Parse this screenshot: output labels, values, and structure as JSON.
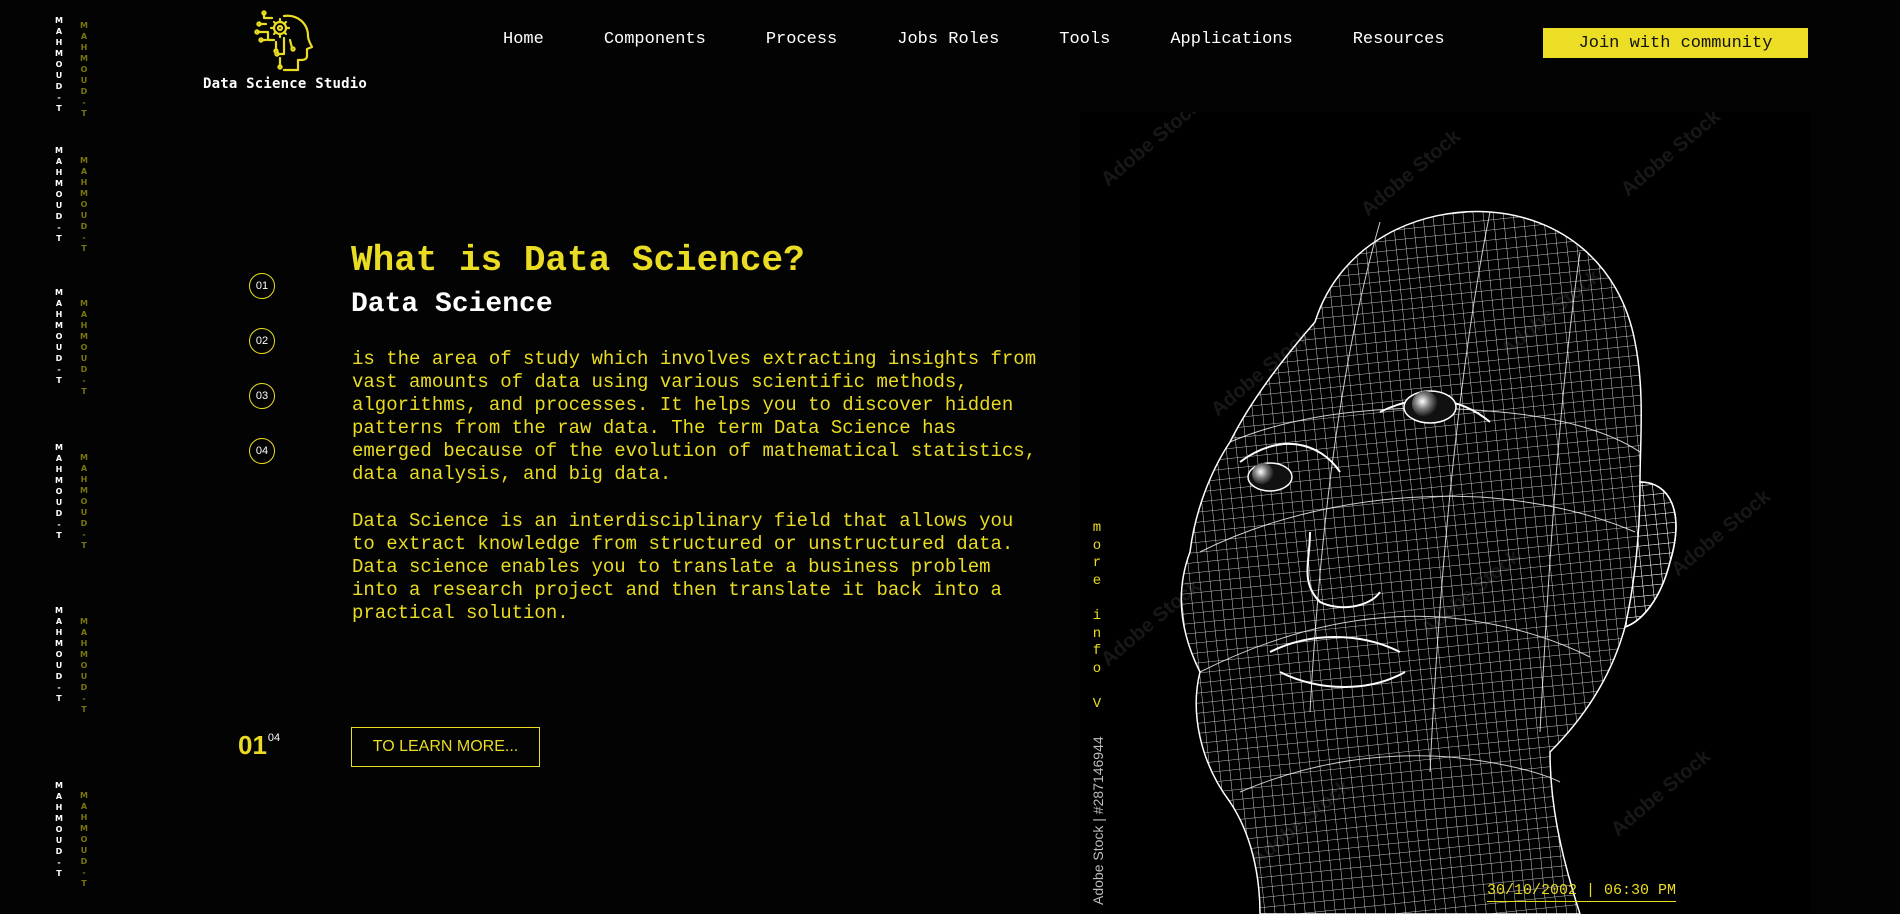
{
  "brand": {
    "name": "Data Science Studio"
  },
  "nav": {
    "items": [
      "Home",
      "Components",
      "Process",
      "Jobs Roles",
      "Tools",
      "Applications",
      "Resources"
    ],
    "cta": "Join with community"
  },
  "side_strip": {
    "tag_white": "MAHMOUD-T",
    "tag_yellow": "MAHMOUD-T"
  },
  "steps": [
    "01",
    "02",
    "03",
    "04"
  ],
  "content": {
    "title": "What is Data Science?",
    "subtitle": "Data Science",
    "paragraph1": "is the area of study which involves extracting insights from\nvast amounts of data using various scientific methods,\nalgorithms, and processes. It helps you to discover hidden\npatterns from the raw data. The term Data Science has\nemerged because of the evolution of mathematical statistics,\ndata analysis, and big data.",
    "paragraph2": "Data Science is an interdisciplinary field that allows you\nto extract knowledge from structured or unstructured data.\nData science enables you to translate a business problem\ninto a research project and then translate it back into a\npractical solution.",
    "counter_current": "01",
    "counter_total": "04",
    "learn_more": "TO LEARN MORE..."
  },
  "more_info": "more info V",
  "hero": {
    "stock_id": "Adobe Stock | #287146944",
    "watermark": "Adobe Stock",
    "icon": "wireframe-head"
  },
  "datetime": "30/10/2002 | 06:30 PM",
  "colors": {
    "accent": "#e9dc22",
    "background": "#030303",
    "text": "#ffffff"
  }
}
